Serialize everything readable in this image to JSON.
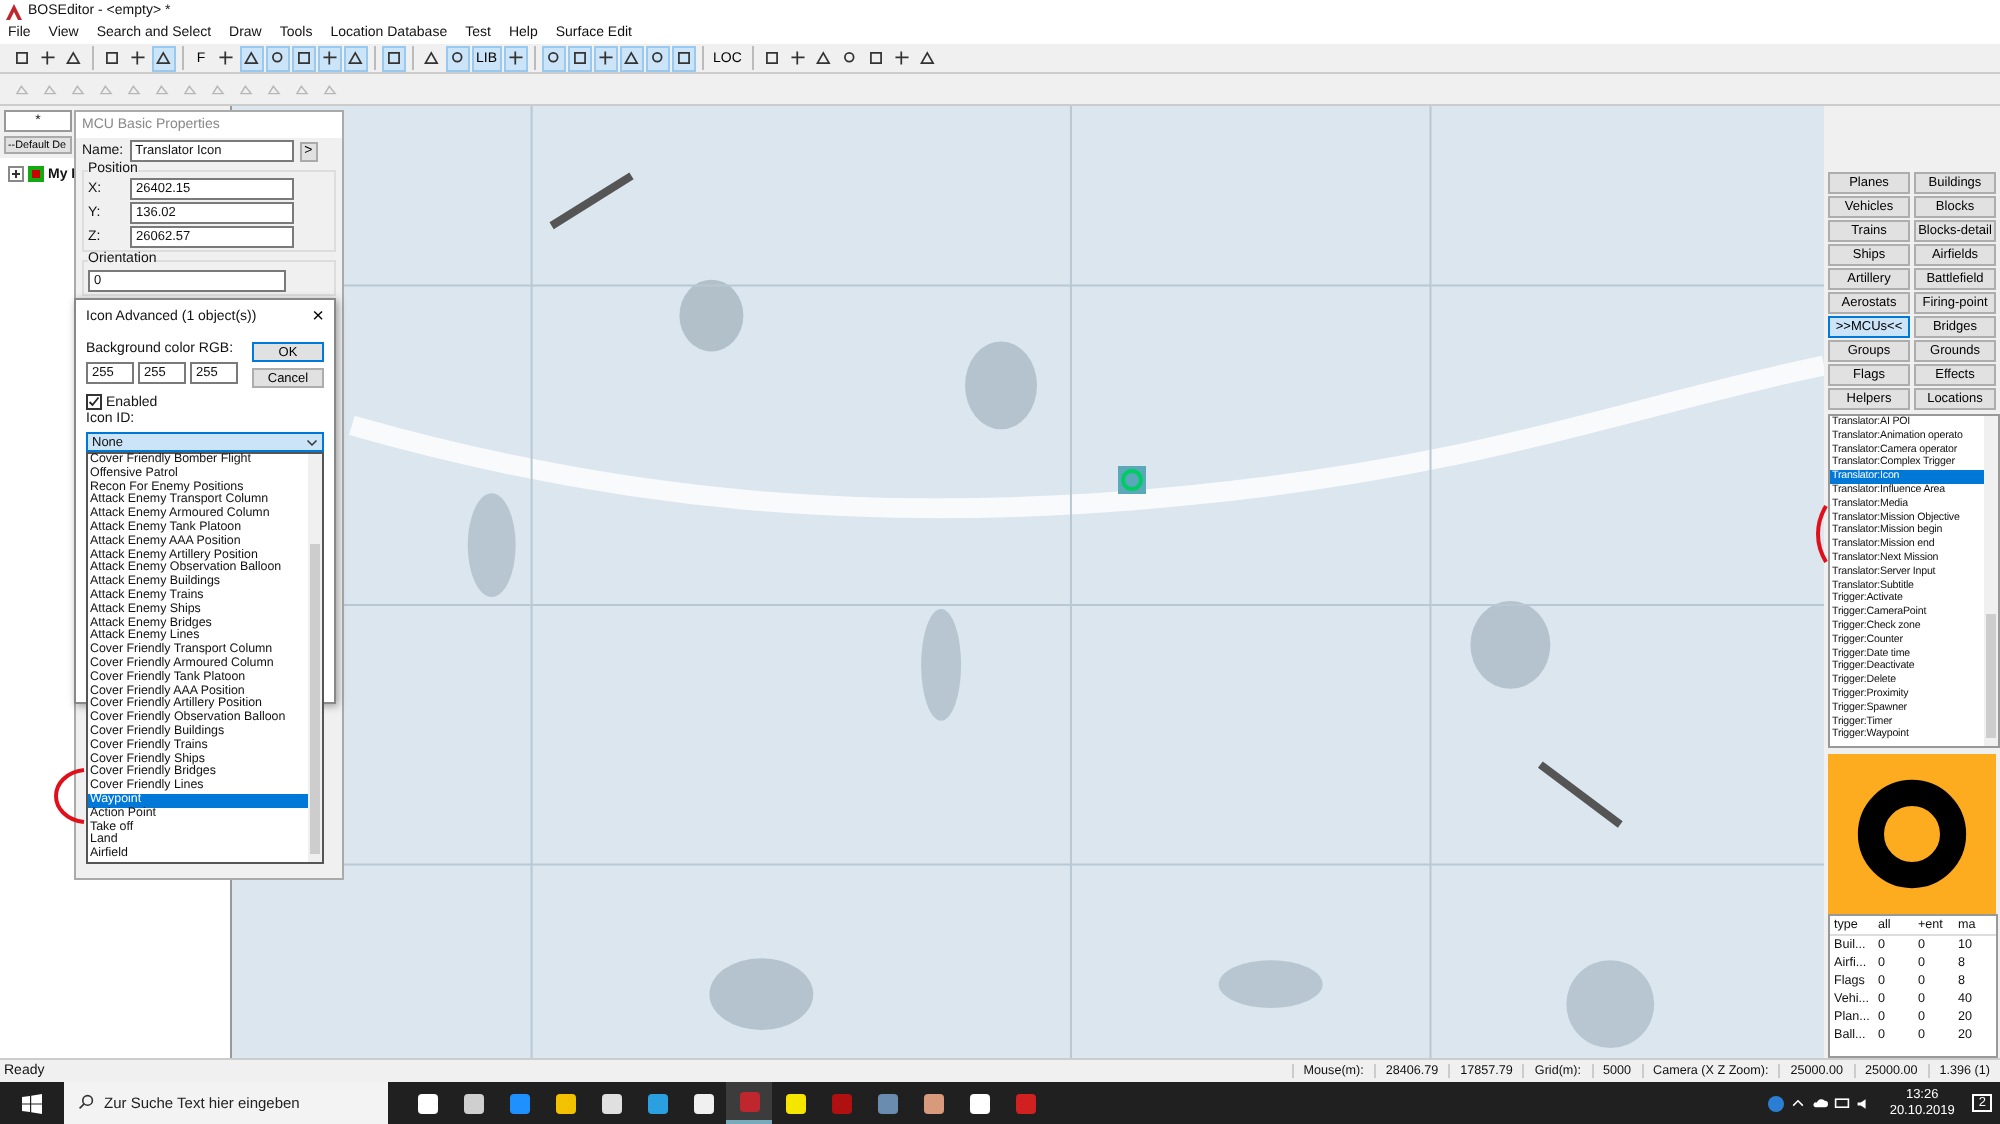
{
  "window": {
    "title": "BOSEditor - <empty> *"
  },
  "menu": [
    "File",
    "View",
    "Search and Select",
    "Draw",
    "Tools",
    "Location Database",
    "Test",
    "Help",
    "Surface Edit"
  ],
  "toolbar": [
    {
      "kind": "icon",
      "selected": false
    },
    {
      "kind": "icon",
      "selected": false
    },
    {
      "kind": "icon",
      "selected": false
    },
    {
      "kind": "separator"
    },
    {
      "kind": "icon",
      "selected": false
    },
    {
      "kind": "icon",
      "selected": false
    },
    {
      "kind": "icon",
      "selected": true
    },
    {
      "kind": "separator"
    },
    {
      "kind": "text",
      "label": "F",
      "selected": false
    },
    {
      "kind": "icon",
      "selected": false
    },
    {
      "kind": "icon",
      "selected": true
    },
    {
      "kind": "icon",
      "selected": true
    },
    {
      "kind": "icon",
      "selected": true
    },
    {
      "kind": "icon",
      "selected": true
    },
    {
      "kind": "icon",
      "selected": true
    },
    {
      "kind": "separator"
    },
    {
      "kind": "icon",
      "selected": true
    },
    {
      "kind": "separator"
    },
    {
      "kind": "icon",
      "selected": false
    },
    {
      "kind": "icon",
      "selected": true
    },
    {
      "kind": "text",
      "label": "LIB",
      "selected": true
    },
    {
      "kind": "icon",
      "selected": true
    },
    {
      "kind": "separator"
    },
    {
      "kind": "icon",
      "selected": true
    },
    {
      "kind": "icon",
      "selected": true
    },
    {
      "kind": "icon",
      "selected": true
    },
    {
      "kind": "icon",
      "selected": true
    },
    {
      "kind": "icon",
      "selected": true
    },
    {
      "kind": "icon",
      "selected": true
    },
    {
      "kind": "separator"
    },
    {
      "kind": "text",
      "label": "LOC",
      "selected": false
    },
    {
      "kind": "separator"
    },
    {
      "kind": "icon",
      "selected": false
    },
    {
      "kind": "icon",
      "selected": false
    },
    {
      "kind": "icon",
      "selected": false
    },
    {
      "kind": "icon",
      "selected": false
    },
    {
      "kind": "icon",
      "selected": false
    },
    {
      "kind": "icon",
      "selected": false
    },
    {
      "kind": "icon",
      "selected": false
    }
  ],
  "left_panel": {
    "combo_value": "*",
    "default_button": "--Default De",
    "tree": [
      {
        "label": "My I",
        "expanded": false
      }
    ]
  },
  "mcu_window": {
    "title": "MCU Basic Properties",
    "name_label": "Name:",
    "name_value": "Translator Icon",
    "more_button": ">",
    "position_group": "Position",
    "fields": [
      {
        "label": "X:",
        "value": "26402.15"
      },
      {
        "label": "Y:",
        "value": "136.02"
      },
      {
        "label": "Z:",
        "value": "26062.57"
      }
    ],
    "orientation_group": "Orientation",
    "orientation_value": "0"
  },
  "icon_dialog": {
    "title": "Icon Advanced (1 object(s))",
    "close": "×",
    "bg_label": "Background color RGB:",
    "rgb": [
      "255",
      "255",
      "255"
    ],
    "ok": "OK",
    "cancel": "Cancel",
    "enabled": {
      "label": "Enabled",
      "checked": true
    },
    "icon_id_label": "Icon ID:",
    "combo_value": "None",
    "options": [
      {
        "label": "Cover Friendly Bomber Flight",
        "selected": false
      },
      {
        "label": "Offensive Patrol",
        "selected": false
      },
      {
        "label": "Recon For Enemy Positions",
        "selected": false
      },
      {
        "label": "Attack Enemy Transport Column",
        "selected": false
      },
      {
        "label": "Attack Enemy Armoured Column",
        "selected": false
      },
      {
        "label": "Attack Enemy Tank Platoon",
        "selected": false
      },
      {
        "label": "Attack Enemy AAA Position",
        "selected": false
      },
      {
        "label": "Attack Enemy Artillery Position",
        "selected": false
      },
      {
        "label": "Attack Enemy Observation Balloon",
        "selected": false
      },
      {
        "label": "Attack Enemy Buildings",
        "selected": false
      },
      {
        "label": "Attack Enemy Trains",
        "selected": false
      },
      {
        "label": "Attack Enemy Ships",
        "selected": false
      },
      {
        "label": "Attack Enemy Bridges",
        "selected": false
      },
      {
        "label": "Attack Enemy Lines",
        "selected": false
      },
      {
        "label": "Cover Friendly Transport Column",
        "selected": false
      },
      {
        "label": "Cover Friendly Armoured Column",
        "selected": false
      },
      {
        "label": "Cover Friendly Tank Platoon",
        "selected": false
      },
      {
        "label": "Cover Friendly AAA Position",
        "selected": false
      },
      {
        "label": "Cover Friendly Artillery Position",
        "selected": false
      },
      {
        "label": "Cover Friendly Observation Balloon",
        "selected": false
      },
      {
        "label": "Cover Friendly Buildings",
        "selected": false
      },
      {
        "label": "Cover Friendly Trains",
        "selected": false
      },
      {
        "label": "Cover Friendly Ships",
        "selected": false
      },
      {
        "label": "Cover Friendly Bridges",
        "selected": false
      },
      {
        "label": "Cover Friendly Lines",
        "selected": false
      },
      {
        "label": "Waypoint",
        "selected": true
      },
      {
        "label": "Action Point",
        "selected": false
      },
      {
        "label": "Take off",
        "selected": false
      },
      {
        "label": "Land",
        "selected": false
      },
      {
        "label": "Airfield",
        "selected": false
      }
    ]
  },
  "right_panel": {
    "categories": [
      {
        "label": "Planes",
        "selected": false
      },
      {
        "label": "Buildings",
        "selected": false
      },
      {
        "label": "Vehicles",
        "selected": false
      },
      {
        "label": "Blocks",
        "selected": false
      },
      {
        "label": "Trains",
        "selected": false
      },
      {
        "label": "Blocks-detail",
        "selected": false
      },
      {
        "label": "Ships",
        "selected": false
      },
      {
        "label": "Airfields",
        "selected": false
      },
      {
        "label": "Artillery",
        "selected": false
      },
      {
        "label": "Battlefield",
        "selected": false
      },
      {
        "label": "Aerostats",
        "selected": false
      },
      {
        "label": "Firing-point",
        "selected": false
      },
      {
        "label": ">>MCUs<<",
        "selected": true
      },
      {
        "label": "Bridges",
        "selected": false
      },
      {
        "label": "Groups",
        "selected": false
      },
      {
        "label": "Grounds",
        "selected": false
      },
      {
        "label": "Flags",
        "selected": false
      },
      {
        "label": "Effects",
        "selected": false
      },
      {
        "label": "Helpers",
        "selected": false
      },
      {
        "label": "Locations",
        "selected": false
      }
    ],
    "objects": [
      {
        "label": "Translator:AI POI",
        "selected": false
      },
      {
        "label": "Translator:Animation operato",
        "selected": false
      },
      {
        "label": "Translator:Camera operator",
        "selected": false
      },
      {
        "label": "Translator:Complex Trigger",
        "selected": false
      },
      {
        "label": "Translator:Icon",
        "selected": true
      },
      {
        "label": "Translator:Influence Area",
        "selected": false
      },
      {
        "label": "Translator:Media",
        "selected": false
      },
      {
        "label": "Translator:Mission Objective",
        "selected": false
      },
      {
        "label": "Translator:Mission begin",
        "selected": false
      },
      {
        "label": "Translator:Mission end",
        "selected": false
      },
      {
        "label": "Translator:Next Mission",
        "selected": false
      },
      {
        "label": "Translator:Server Input",
        "selected": false
      },
      {
        "label": "Translator:Subtitle",
        "selected": false
      },
      {
        "label": "Trigger:Activate",
        "selected": false
      },
      {
        "label": "Trigger:CameraPoint",
        "selected": false
      },
      {
        "label": "Trigger:Check zone",
        "selected": false
      },
      {
        "label": "Trigger:Counter",
        "selected": false
      },
      {
        "label": "Trigger:Date time",
        "selected": false
      },
      {
        "label": "Trigger:Deactivate",
        "selected": false
      },
      {
        "label": "Trigger:Delete",
        "selected": false
      },
      {
        "label": "Trigger:Proximity",
        "selected": false
      },
      {
        "label": "Trigger:Spawner",
        "selected": false
      },
      {
        "label": "Trigger:Timer",
        "selected": false
      },
      {
        "label": "Trigger:Waypoint",
        "selected": false
      }
    ],
    "table": {
      "columns": [
        "type",
        "all",
        "+ent",
        "ma"
      ],
      "rows": [
        [
          "Buil...",
          "0",
          "0",
          "10"
        ],
        [
          "Airfi...",
          "0",
          "0",
          "8"
        ],
        [
          "Flags",
          "0",
          "0",
          "8"
        ],
        [
          "Vehi...",
          "0",
          "0",
          "40"
        ],
        [
          "Plan...",
          "0",
          "0",
          "20"
        ],
        [
          "Ball...",
          "0",
          "0",
          "20"
        ]
      ]
    }
  },
  "status_bar": {
    "left": "Ready",
    "items": [
      "Mouse(m):",
      "28406.79",
      "17857.79",
      "Grid(m):",
      "5000",
      "Camera (X Z Zoom):",
      "25000.00",
      "25000.00",
      "1.396 (1)"
    ]
  },
  "taskbar": {
    "search_placeholder": "Zur Suche Text hier eingeben",
    "apps": [
      {
        "color": "#ffffff",
        "selected": false
      },
      {
        "color": "#cfcfcf",
        "selected": false
      },
      {
        "color": "#1e90ff",
        "selected": false
      },
      {
        "color": "#f2c200",
        "selected": false
      },
      {
        "color": "#e0e0e0",
        "selected": false
      },
      {
        "color": "#2aa0e0",
        "selected": false
      },
      {
        "color": "#f0f0f0",
        "selected": false
      },
      {
        "color": "#c0262d",
        "selected": true
      },
      {
        "color": "#f5e600",
        "selected": false
      },
      {
        "color": "#b01010",
        "selected": false
      },
      {
        "color": "#6a8caf",
        "selected": false
      },
      {
        "color": "#d89a7a",
        "selected": false
      },
      {
        "color": "#ffffff",
        "selected": false
      },
      {
        "color": "#d02020",
        "selected": false
      }
    ],
    "time": "13:26",
    "date": "20.10.2019",
    "notifications": "2"
  }
}
